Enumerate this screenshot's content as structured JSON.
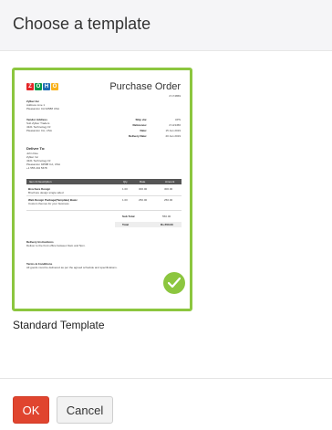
{
  "dialog": {
    "title": "Choose a template"
  },
  "template": {
    "name": "Standard Template",
    "selected": true,
    "accent_color": "#8cc63f",
    "preview": {
      "logo_letters": [
        "Z",
        "O",
        "H",
        "O"
      ],
      "logo_colors": [
        "#e42527",
        "#089949",
        "#226db4",
        "#f9b21d"
      ],
      "title": "Purchase Order",
      "number": "# 174869",
      "company_name": "Zylker Inc",
      "company_lines": [
        "Zylker Inc",
        "Address Line 1",
        "Pleasanton CA 94588 USA"
      ],
      "vendor_heading": "Vendor Address",
      "vendor_lines": [
        "Sub Zylker Traders",
        "4321 Technology Dr",
        "Pleasanton CA, USA"
      ],
      "meta": [
        {
          "label": "Ship via:",
          "value": "UPS"
        },
        {
          "label": "Reference:",
          "value": "# 123456"
        },
        {
          "label": "Date:",
          "value": "15 Jan 2019"
        },
        {
          "label": "Delivery Date:",
          "value": "20 Jan 2019"
        }
      ],
      "deliver_heading": "Deliver To:",
      "deliver_lines": [
        "John Doe",
        "Zylker Inc",
        "4321 Technology Dr",
        "Pleasanton 94588 CA, USA",
        "+1 555 234 5678"
      ],
      "table_headers": [
        "Item & Description",
        "Qty",
        "Rate",
        "Amount"
      ],
      "rows": [
        {
          "name": "Brochure Design",
          "desc": "Brochure design single sided",
          "qty": "1.00",
          "rate": "300.00",
          "amount": "300.00"
        },
        {
          "name": "Web Design Package(Template) Basic",
          "desc": "Custom themes for your business",
          "qty": "1.00",
          "rate": "250.00",
          "amount": "250.00"
        }
      ],
      "sub_total_label": "Sub Total",
      "sub_total": "550.00",
      "total_label": "Total",
      "total": "Rs.550.00",
      "delivery_heading": "Delivery Instructions",
      "delivery_text": "Deliver to the front office between 9am and 5pm.",
      "terms_heading": "Terms & Conditions",
      "terms_text": "All goods must be delivered as per the agreed schedule and specifications."
    }
  },
  "buttons": {
    "ok": "OK",
    "cancel": "Cancel"
  }
}
